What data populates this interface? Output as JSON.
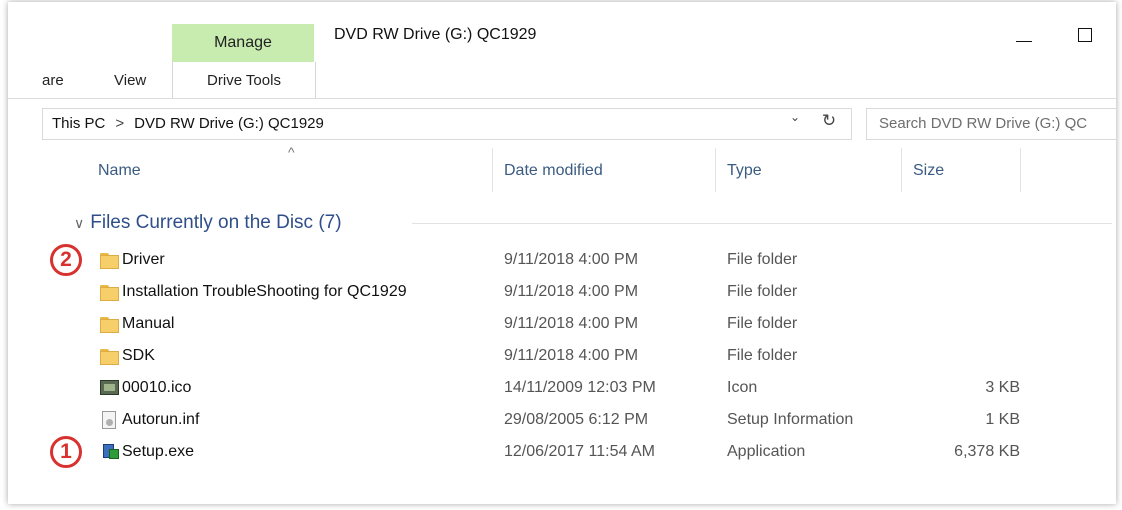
{
  "ribbon": {
    "context_label": "Manage",
    "context_tab": "Drive Tools",
    "tabs": [
      "are",
      "View"
    ]
  },
  "window": {
    "title": "DVD RW Drive (G:) QC1929",
    "minimize_glyph": "—",
    "maximize_glyph": "☐"
  },
  "address": {
    "crumbs": [
      "This PC",
      "DVD RW Drive (G:) QC1929"
    ],
    "separator": ">",
    "dropdown_glyph": "⌄",
    "refresh_glyph": "↻"
  },
  "search": {
    "placeholder": "Search DVD RW Drive (G:) QC"
  },
  "columns": {
    "name": "Name",
    "date": "Date modified",
    "type": "Type",
    "size": "Size",
    "sort_glyph": "^"
  },
  "group": {
    "chevron": "∨",
    "label": "Files Currently on the Disc (7)"
  },
  "files": [
    {
      "name": "Driver",
      "date": "9/11/2018 4:00 PM",
      "type": "File folder",
      "size": "",
      "icon": "folder-icon"
    },
    {
      "name": "Installation TroubleShooting for QC1929",
      "date": "9/11/2018 4:00 PM",
      "type": "File folder",
      "size": "",
      "icon": "folder-icon"
    },
    {
      "name": "Manual",
      "date": "9/11/2018 4:00 PM",
      "type": "File folder",
      "size": "",
      "icon": "folder-icon"
    },
    {
      "name": "SDK",
      "date": "9/11/2018 4:00 PM",
      "type": "File folder",
      "size": "",
      "icon": "folder-icon"
    },
    {
      "name": "00010.ico",
      "date": "14/11/2009 12:03 PM",
      "type": "Icon",
      "size": "3 KB",
      "icon": "image-file-icon"
    },
    {
      "name": "Autorun.inf",
      "date": "29/08/2005 6:12 PM",
      "type": "Setup Information",
      "size": "1 KB",
      "icon": "setup-info-file-icon"
    },
    {
      "name": "Setup.exe",
      "date": "12/06/2017 11:54 AM",
      "type": "Application",
      "size": "6,378 KB",
      "icon": "setup-application-icon"
    }
  ],
  "annotations": {
    "badge_1": "1",
    "badge_2": "2",
    "color": "#d8322f"
  },
  "colors": {
    "context_tab": "#c8ecb0",
    "group_header": "#2f4e8a",
    "column_header": "#3a5b82"
  }
}
